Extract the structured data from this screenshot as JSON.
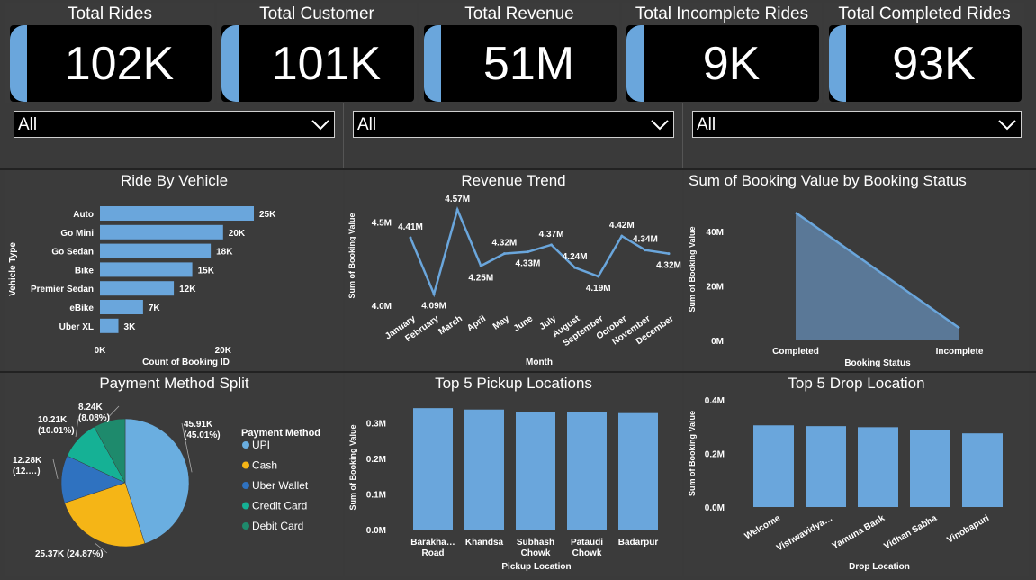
{
  "kpis": [
    {
      "title": "Total Rides",
      "value": "102K"
    },
    {
      "title": "Total Customer",
      "value": "101K"
    },
    {
      "title": "Total Revenue",
      "value": "51M"
    },
    {
      "title": "Total Incomplete Rides",
      "value": "9K"
    },
    {
      "title": "Total Completed Rides",
      "value": "93K"
    }
  ],
  "slicers": [
    {
      "value": "All"
    },
    {
      "value": "All"
    },
    {
      "value": "All"
    }
  ],
  "colors": {
    "bar": "#6aa6dc",
    "background": "#3a3a3a",
    "card": "#000000",
    "area_fill": "#5a7897"
  },
  "icons": {
    "dropdown": "chevron-down-icon"
  },
  "chart_data": [
    {
      "id": "ride_by_vehicle",
      "type": "bar",
      "orientation": "horizontal",
      "title": "Ride By Vehicle",
      "xlabel": "Count of Booking ID",
      "ylabel": "Vehicle Type",
      "categories": [
        "Auto",
        "Go Mini",
        "Go Sedan",
        "Bike",
        "Premier Sedan",
        "eBike",
        "Uber XL"
      ],
      "values": [
        25,
        20,
        18,
        15,
        12,
        7,
        3
      ],
      "data_labels": [
        "25K",
        "20K",
        "18K",
        "15K",
        "12K",
        "7K",
        "3K"
      ],
      "xlim": [
        0,
        25
      ],
      "xticks": [
        "0K",
        "20K"
      ],
      "grid": false
    },
    {
      "id": "revenue_trend",
      "type": "line",
      "title": "Revenue Trend",
      "xlabel": "Month",
      "ylabel": "Sum of Booking Value",
      "categories": [
        "January",
        "February",
        "March",
        "April",
        "May",
        "June",
        "July",
        "August",
        "September",
        "October",
        "November",
        "December"
      ],
      "values": [
        4.41,
        4.09,
        4.57,
        4.25,
        4.32,
        4.33,
        4.37,
        4.24,
        4.19,
        4.42,
        4.34,
        4.32
      ],
      "data_labels": [
        "4.41M",
        "4.09M",
        "4.57M",
        "4.25M",
        "4.32M",
        "4.33M",
        "4.37M",
        "4.24M",
        "4.19M",
        "4.42M",
        "4.34M",
        "4.32M"
      ],
      "ylim": [
        4.0,
        4.6
      ],
      "yticks": [
        "4.0M",
        "4.5M"
      ],
      "grid": false
    },
    {
      "id": "booking_status",
      "type": "area",
      "title": "Sum of Booking Value by Booking Status",
      "xlabel": "Booking Status",
      "ylabel": "Sum of Booking Value",
      "categories": [
        "Completed",
        "Incomplete"
      ],
      "values": [
        47,
        4.5
      ],
      "ylim": [
        0,
        50
      ],
      "yticks": [
        "0M",
        "20M",
        "40M"
      ],
      "grid": false
    },
    {
      "id": "payment_method",
      "type": "pie",
      "title": "Payment Method Split",
      "legend_title": "Payment Method",
      "legend_position": "right",
      "series": [
        {
          "name": "UPI",
          "value": 45.91,
          "label": "45.91K",
          "pct_label": "(45.01%)",
          "color": "#6aaee0"
        },
        {
          "name": "Cash",
          "value": 25.37,
          "label": "25.37K (24.87%)",
          "pct_label": "",
          "color": "#f5b516"
        },
        {
          "name": "Uber Wallet",
          "value": 12.28,
          "label": "12.28K",
          "pct_label": "(12.…)",
          "color": "#2f72c0"
        },
        {
          "name": "Credit Card",
          "value": 10.21,
          "label": "10.21K",
          "pct_label": "(10.01%)",
          "color": "#15b195"
        },
        {
          "name": "Debit Card",
          "value": 8.24,
          "label": "8.24K",
          "pct_label": "(8.08%)",
          "color": "#1e8a6c"
        }
      ]
    },
    {
      "id": "top_pickup",
      "type": "bar",
      "title": "Top 5 Pickup Locations",
      "xlabel": "Pickup Location",
      "ylabel": "Sum of Booking Value",
      "categories": [
        "Barakha… Road",
        "Khandsa",
        "Subhash Chowk",
        "Pataudi Chowk",
        "Badarpur"
      ],
      "values": [
        0.342,
        0.338,
        0.331,
        0.33,
        0.328
      ],
      "ylim": [
        0,
        0.35
      ],
      "yticks": [
        "0.0M",
        "0.1M",
        "0.2M",
        "0.3M"
      ],
      "grid": false
    },
    {
      "id": "top_drop",
      "type": "bar",
      "title": "Top 5 Drop Location",
      "xlabel": "Drop Location",
      "ylabel": "Sum of Booking Value",
      "categories": [
        "Welcome",
        "Vishwavidya…",
        "Yamuna Bank",
        "Vidhan Sabha",
        "Vinobapuri"
      ],
      "values": [
        0.305,
        0.302,
        0.298,
        0.289,
        0.275
      ],
      "ylim": [
        0,
        0.4
      ],
      "yticks": [
        "0.0M",
        "0.2M",
        "0.4M"
      ],
      "grid": false
    }
  ]
}
